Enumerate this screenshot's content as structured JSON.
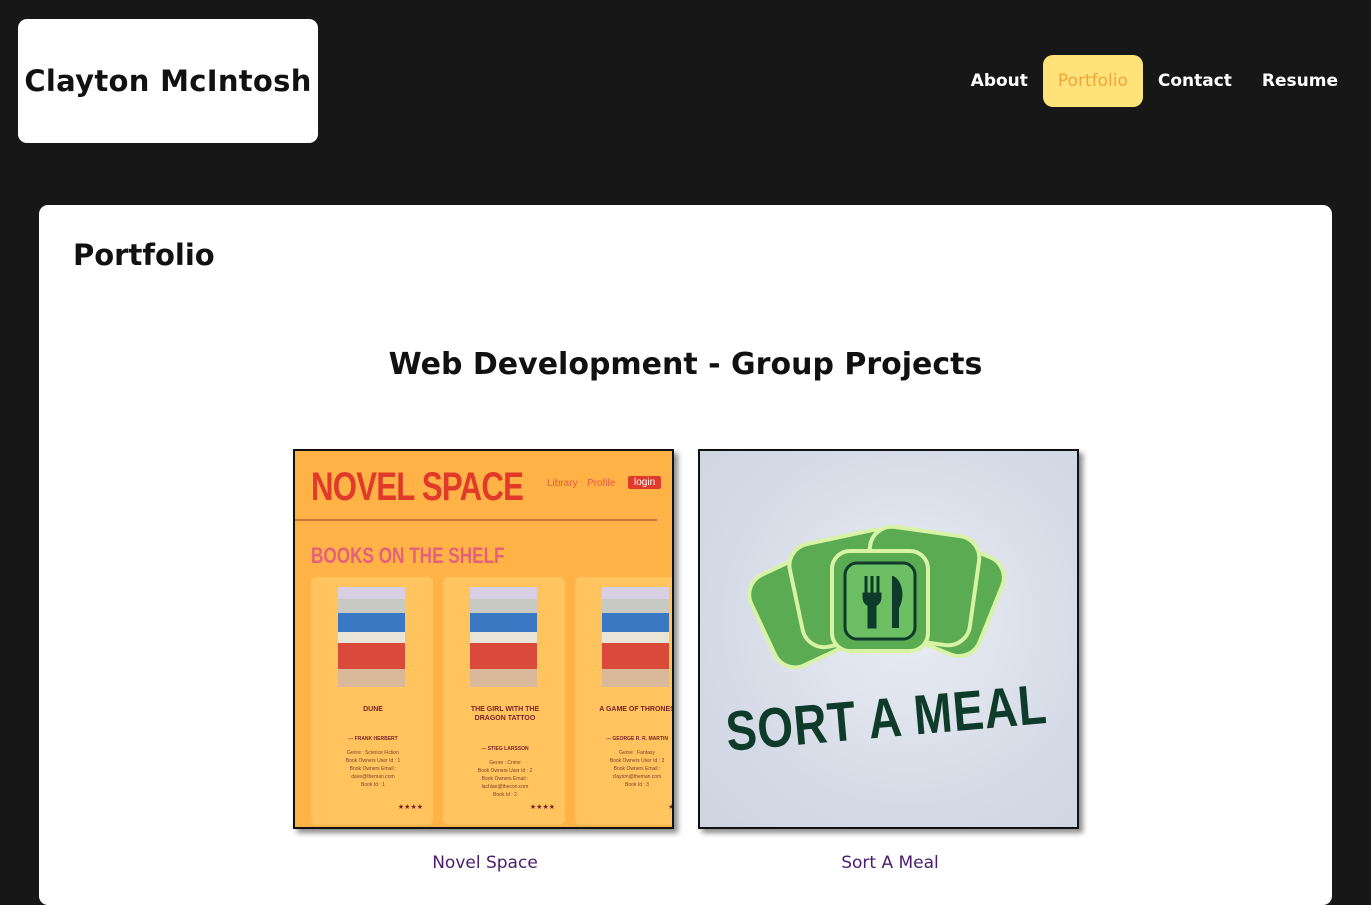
{
  "brand": {
    "name": "Clayton McIntosh"
  },
  "nav": {
    "items": [
      {
        "label": "About"
      },
      {
        "label": "Portfolio"
      },
      {
        "label": "Contact"
      },
      {
        "label": "Resume"
      }
    ],
    "active": "Portfolio"
  },
  "main": {
    "title": "Portfolio",
    "section_title": "Web Development - Group Projects",
    "projects": [
      {
        "title": "Novel Space",
        "thumbnail": {
          "logo": "NOVEL SPACE",
          "nav_links": [
            "Library",
            "Profile"
          ],
          "login_label": "login",
          "heading": "BOOKS ON THE SHELF",
          "books": [
            {
              "title": "DUNE",
              "author": "--- FRANK HERBERT",
              "genre": "Genre : Science Fiction",
              "owner_id": "Book Owners User Id : 1",
              "owner_email_label": "Book Owners Email :",
              "owner_email": "dave@theman.com",
              "book_id": "Book Id : 1",
              "stars": "★★★★"
            },
            {
              "title": "THE GIRL WITH THE DRAGON TATTOO",
              "author": "--- STIEG LARSSON",
              "genre": "Genre : Crime",
              "owner_id": "Book Owners User Id : 2",
              "owner_email_label": "Book Owners Email :",
              "owner_email": "lachlan@thecon.com",
              "book_id": "Book Id : 2",
              "stars": "★★★★"
            },
            {
              "title": "A GAME OF THRONES",
              "author": "--- GEORGE R. R. MARTIN",
              "genre": "Genre : Fantasy",
              "owner_id": "Book Owners User Id : 3",
              "owner_email_label": "Book Owners Email :",
              "owner_email": "clayton@theman.com",
              "book_id": "Book Id : 3",
              "stars": "★★★"
            }
          ]
        }
      },
      {
        "title": "Sort A Meal",
        "thumbnail": {
          "logo_text": "SORT A MEAL"
        }
      }
    ]
  },
  "colors": {
    "page_background": "#171717",
    "nav_active_background": "#ffe27a",
    "nav_active_text": "#f0a53a",
    "project_link": "#4b1c6e",
    "novel_space_background": "#ffb347",
    "novel_space_red": "#e13a2a",
    "sort_a_meal_green": "#5aab52",
    "sort_a_meal_text": "#0e3b2a"
  }
}
